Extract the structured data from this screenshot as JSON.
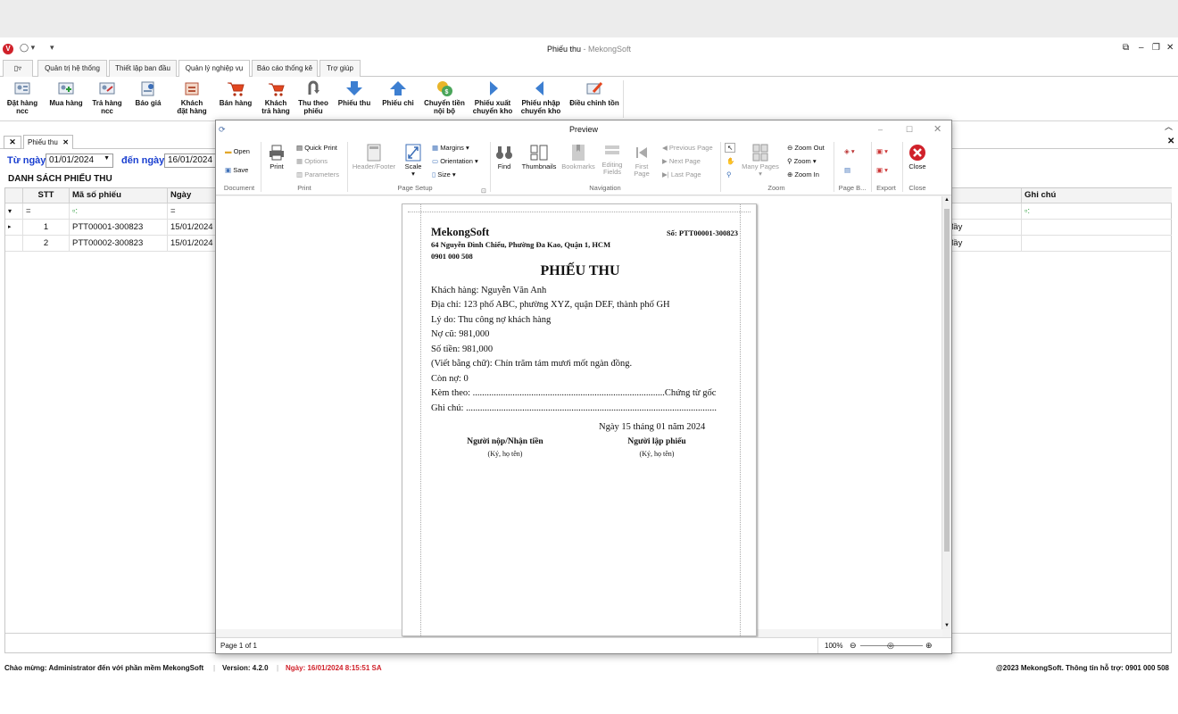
{
  "app": {
    "title": "Phiếu thu",
    "subtitle": " - MekongSoft",
    "logo": "V"
  },
  "menu_tabs": [
    "Quản trị hệ thống",
    "Thiết lập ban đầu",
    "Quản lý nghiệp vụ",
    "Báo cáo thống kê",
    "Trợ giúp"
  ],
  "ribbon": [
    {
      "l1": "Đặt hàng",
      "l2": "ncc",
      "icon": "order-supplier-icon"
    },
    {
      "l1": "Mua hàng",
      "l2": "",
      "icon": "purchase-icon"
    },
    {
      "l1": "Trả hàng",
      "l2": "ncc",
      "icon": "return-supplier-icon"
    },
    {
      "l1": "Báo giá",
      "l2": "",
      "icon": "quote-icon"
    },
    {
      "l1": "Khách",
      "l2": "đặt hàng",
      "icon": "customer-order-icon"
    },
    {
      "l1": "Bán hàng",
      "l2": "",
      "icon": "cart-icon"
    },
    {
      "l1": "Khách",
      "l2": "trả hàng",
      "icon": "customer-return-icon"
    },
    {
      "l1": "Thu theo",
      "l2": "phiếu",
      "icon": "collect-icon"
    },
    {
      "l1": "Phiếu thu",
      "l2": "",
      "icon": "receipt-down-icon"
    },
    {
      "l1": "Phiếu chi",
      "l2": "",
      "icon": "payment-up-icon"
    },
    {
      "l1": "Chuyển tiền",
      "l2": "nội bộ",
      "icon": "transfer-money-icon"
    },
    {
      "l1": "Phiếu xuất",
      "l2": "chuyển kho",
      "icon": "export-warehouse-icon"
    },
    {
      "l1": "Phiếu nhập",
      "l2": "chuyển kho",
      "icon": "import-warehouse-icon"
    },
    {
      "l1": "Điều chỉnh tồn",
      "l2": "",
      "icon": "adjust-stock-icon"
    }
  ],
  "doc_tab": "Phiếu thu",
  "filter": {
    "from_label": "Từ ngày",
    "from_value": "01/01/2024",
    "to_label": "đến ngày",
    "to_value": "16/01/2024"
  },
  "list_title": "DANH SÁCH PHIẾU THU",
  "grid": {
    "columns": [
      "STT",
      "Mã số phiếu",
      "Ngày",
      "Ghi chú"
    ],
    "filter_eq": "=",
    "filter_contains": "▫:",
    "rows": [
      {
        "stt": "1",
        "ma": "PTT00001-300823",
        "ngay": "15/01/2024",
        "tail": "đầy"
      },
      {
        "stt": "2",
        "ma": "PTT00002-300823",
        "ngay": "15/01/2024",
        "tail": "đầy"
      }
    ]
  },
  "status": {
    "welcome": "Chào mừng: Administrator đến với phần mềm MekongSoft",
    "version": "Version: 4.2.0",
    "date": "Ngày: 16/01/2024 8:15:51 SA",
    "copyright": "@2023 MekongSoft. Thông tin hỗ trợ: 0901 000 508"
  },
  "preview": {
    "title": "Preview",
    "open": "Open",
    "save": "Save",
    "group_document": "Document",
    "print": "Print",
    "quick_print": "Quick Print",
    "options": "Options",
    "parameters": "Parameters",
    "group_print": "Print",
    "header_footer": "Header/Footer",
    "scale": "Scale",
    "margins": "Margins",
    "orientation": "Orientation",
    "size": "Size",
    "group_page_setup": "Page Setup",
    "find": "Find",
    "thumbnails": "Thumbnails",
    "bookmarks": "Bookmarks",
    "editing_fields": "Editing Fields",
    "first_page": "First Page",
    "previous_page": "Previous Page",
    "next_page": "Next Page",
    "last_page": "Last Page",
    "group_navigation": "Navigation",
    "many_pages": "Many Pages",
    "zoom_out": "Zoom Out",
    "zoom": "Zoom",
    "zoom_in": "Zoom In",
    "group_zoom": "Zoom",
    "group_page_b": "Page B...",
    "group_export": "Export",
    "close": "Close",
    "group_close": "Close",
    "page_info": "Page 1 of 1",
    "zoom_level": "100%"
  },
  "receipt": {
    "company": "MekongSoft",
    "number": "Số: PTT00001-300823",
    "address": "64 Nguyễn Đình Chiểu, Phường Đa Kao, Quận 1, HCM",
    "phone": "0901 000 508",
    "title": "PHIẾU THU",
    "customer": "Khách hàng:   Nguyễn Văn Anh",
    "addr_line": "Địa chỉ:   123 phố ABC, phường XYZ, quận DEF, thành phố GH",
    "reason": "Lý do:   Thu công nợ khách hàng",
    "old_debt": "Nợ cũ:   981,000",
    "amount": "Số tiền:   981,000",
    "in_words": "(Viết bằng chữ):  Chín trăm tám mươi mốt ngàn đồng.",
    "remaining": "Còn nợ:   0",
    "attached": "Kèm theo:   ..................................................................................Chứng từ gốc",
    "note": "Ghi chú:  ...........................................................................................................",
    "date": "Ngày 15 tháng 01 năm 2024",
    "sign1": "Người nộp/Nhận tiền",
    "sign1_sub": "(Ký, họ tên)",
    "sign2": "Người lập phiếu",
    "sign2_sub": "(Ký, họ tên)"
  }
}
